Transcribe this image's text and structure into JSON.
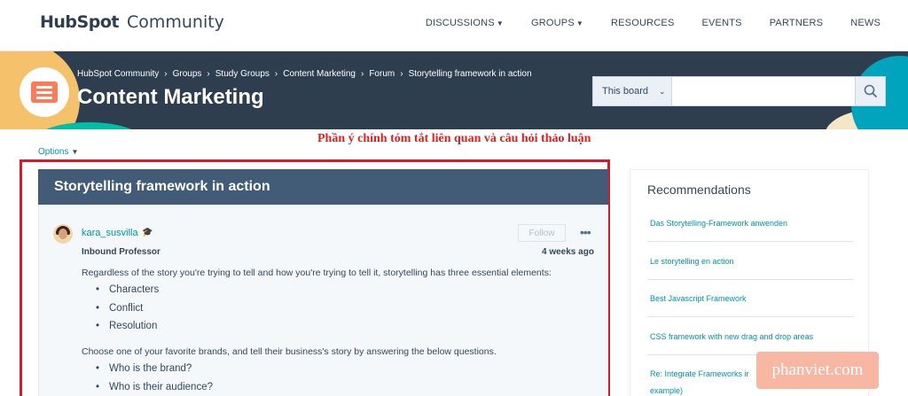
{
  "header": {
    "logo_text": "HubSpot",
    "logo_suffix": "Community",
    "nav": [
      {
        "label": "DISCUSSIONS",
        "dropdown": true
      },
      {
        "label": "GROUPS",
        "dropdown": true
      },
      {
        "label": "RESOURCES",
        "dropdown": false
      },
      {
        "label": "EVENTS",
        "dropdown": false
      },
      {
        "label": "PARTNERS",
        "dropdown": false
      },
      {
        "label": "NEWS",
        "dropdown": false
      }
    ]
  },
  "banner": {
    "breadcrumb": [
      "HubSpot Community",
      "Groups",
      "Study Groups",
      "Content Marketing",
      "Forum",
      "Storytelling framework in action"
    ],
    "title": "Content Marketing",
    "search": {
      "scope": "This board",
      "placeholder": "",
      "icon": "search-icon"
    }
  },
  "options_label": "Options",
  "annotation": "Phần ý chính tóm tắt liên quan và câu hỏi thảo luận",
  "post": {
    "title": "Storytelling framework in action",
    "author": "kara_susvilla",
    "rank": "Inbound Professor",
    "time": "4 weeks ago",
    "follow_label": "Follow",
    "more_label": "•••",
    "intro": "Regardless of the story you're trying to tell and how you're trying to tell it, storytelling has three essential elements:",
    "elements": [
      "Characters",
      "Conflict",
      "Resolution"
    ],
    "prompt": "Choose one of your favorite brands, and tell their business's story by answering the below questions.",
    "questions": [
      "Who is the brand?",
      "Who is their audience?"
    ]
  },
  "sidebar": {
    "title": "Recommendations",
    "items": [
      "Das Storytelling-Framework anwenden",
      "Le storytelling en action",
      "Best Javascript Framework",
      "CSS framework with new drag and drop areas",
      "Re: Integrate Frameworks ir",
      "example)"
    ]
  },
  "watermark": "phanviet.com",
  "colors": {
    "nav_bg": "#ffffff",
    "banner_bg": "#2f3e4e",
    "accent": "#ff7a59",
    "link": "#0091ae",
    "post_header": "#425b76",
    "highlight_box": "#d31b2c"
  }
}
